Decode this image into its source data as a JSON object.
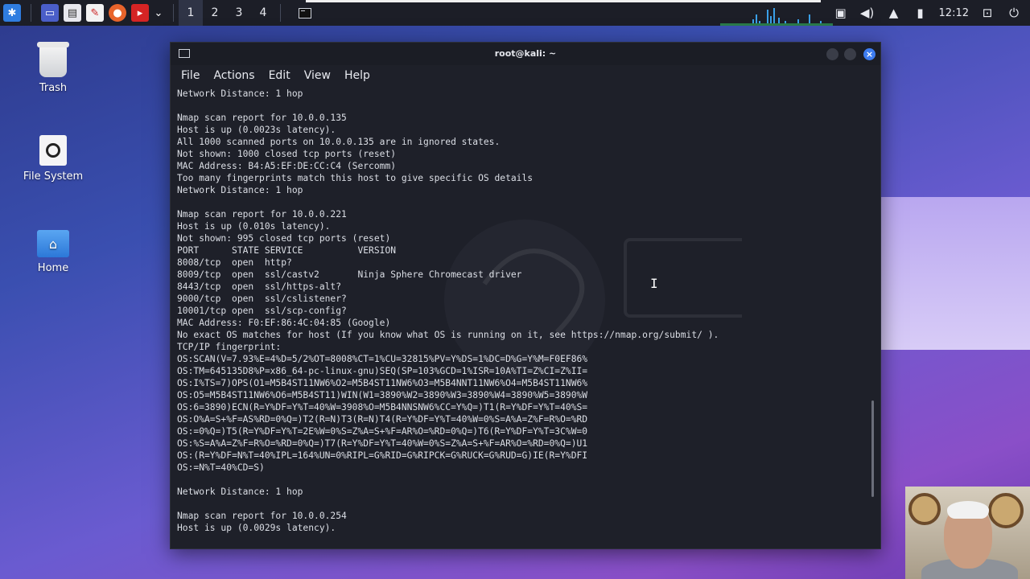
{
  "panel": {
    "workspaces": [
      "1",
      "2",
      "3",
      "4"
    ],
    "clock": "12:12",
    "launcher_icons": [
      "kali-menu-icon",
      "show-desktop-icon",
      "file-manager-icon",
      "text-editor-icon",
      "firefox-icon",
      "terminal-red-icon"
    ],
    "tray_icons": [
      "screenshot-icon",
      "volume-icon",
      "notifications-icon",
      "battery-icon",
      "lock-icon",
      "power-icon"
    ]
  },
  "desktop": {
    "icons": [
      {
        "label": "Trash"
      },
      {
        "label": "File System"
      },
      {
        "label": "Home"
      }
    ]
  },
  "window": {
    "title": "root@kali: ~",
    "menu": [
      "File",
      "Actions",
      "Edit",
      "View",
      "Help"
    ],
    "lines": [
      "Network Distance: 1 hop",
      "",
      "Nmap scan report for 10.0.0.135",
      "Host is up (0.0023s latency).",
      "All 1000 scanned ports on 10.0.0.135 are in ignored states.",
      "Not shown: 1000 closed tcp ports (reset)",
      "MAC Address: B4:A5:EF:DE:CC:C4 (Sercomm)",
      "Too many fingerprints match this host to give specific OS details",
      "Network Distance: 1 hop",
      "",
      "Nmap scan report for 10.0.0.221",
      "Host is up (0.010s latency).",
      "Not shown: 995 closed tcp ports (reset)",
      "PORT      STATE SERVICE          VERSION",
      "8008/tcp  open  http?",
      "8009/tcp  open  ssl/castv2       Ninja Sphere Chromecast driver",
      "8443/tcp  open  ssl/https-alt?",
      "9000/tcp  open  ssl/cslistener?",
      "10001/tcp open  ssl/scp-config?",
      "MAC Address: F0:EF:86:4C:04:85 (Google)",
      "No exact OS matches for host (If you know what OS is running on it, see https://nmap.org/submit/ ).",
      "TCP/IP fingerprint:",
      "OS:SCAN(V=7.93%E=4%D=5/2%OT=8008%CT=1%CU=32815%PV=Y%DS=1%DC=D%G=Y%M=F0EF86%",
      "OS:TM=645135D8%P=x86_64-pc-linux-gnu)SEQ(SP=103%GCD=1%ISR=10A%TI=Z%CI=Z%II=",
      "OS:I%TS=7)OPS(O1=M5B4ST11NW6%O2=M5B4ST11NW6%O3=M5B4NNT11NW6%O4=M5B4ST11NW6%",
      "OS:O5=M5B4ST11NW6%O6=M5B4ST11)WIN(W1=3890%W2=3890%W3=3890%W4=3890%W5=3890%W",
      "OS:6=3890)ECN(R=Y%DF=Y%T=40%W=3908%O=M5B4NNSNW6%CC=Y%Q=)T1(R=Y%DF=Y%T=40%S=",
      "OS:O%A=S+%F=AS%RD=0%Q=)T2(R=N)T3(R=N)T4(R=Y%DF=Y%T=40%W=0%S=A%A=Z%F=R%O=%RD",
      "OS:=0%Q=)T5(R=Y%DF=Y%T=2E%W=0%S=Z%A=S+%F=AR%O=%RD=0%Q=)T6(R=Y%DF=Y%T=3C%W=0",
      "OS:%S=A%A=Z%F=R%O=%RD=0%Q=)T7(R=Y%DF=Y%T=40%W=0%S=Z%A=S+%F=AR%O=%RD=0%Q=)U1",
      "OS:(R=Y%DF=N%T=40%IPL=164%UN=0%RIPL=G%RID=G%RIPCK=G%RUCK=G%RUD=G)IE(R=Y%DFI",
      "OS:=N%T=40%CD=S)",
      "",
      "Network Distance: 1 hop",
      "",
      "Nmap scan report for 10.0.0.254",
      "Host is up (0.0029s latency)."
    ]
  },
  "colors": {
    "panel_bg": "#1c1e27",
    "terminal_bg": "#1e2029",
    "close_button": "#3d7cf0"
  }
}
